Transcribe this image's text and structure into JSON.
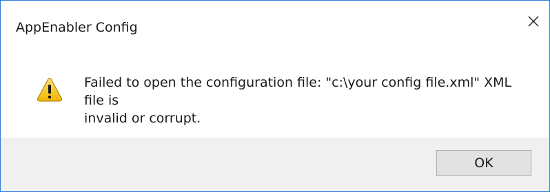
{
  "window": {
    "title": "AppEnabler Config",
    "close_icon": "close-icon"
  },
  "content": {
    "icon": "warning-icon",
    "message": "Failed to open the configuration file: \"c:\\your config file.xml\" XML file is\ninvalid or corrupt."
  },
  "footer": {
    "ok_label": "OK"
  },
  "colors": {
    "border": "#2b7ad8",
    "footer_bg": "#f0f0f0",
    "warning_fill": "#f7c600",
    "button_bg": "#e1e1e1"
  }
}
